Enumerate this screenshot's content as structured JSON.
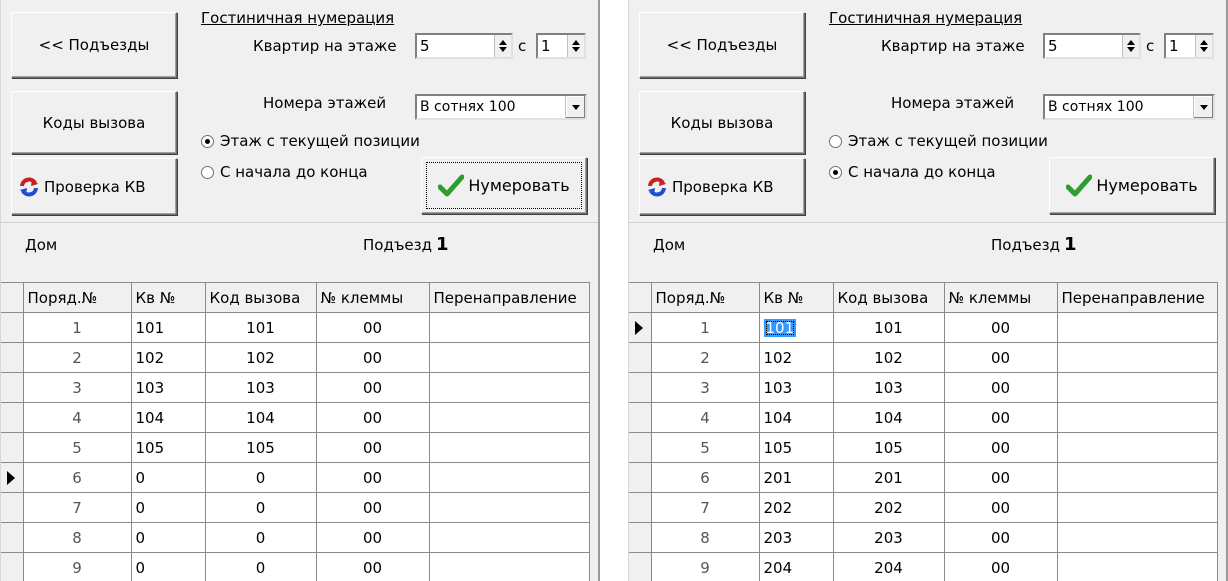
{
  "left": {
    "nav_button": "<< Подъезды",
    "codes_button": "Коды вызова",
    "check_button": "Проверка КВ",
    "hotel_link": "Гостиничная нумерация",
    "apt_per_floor_label": "Квартир на этаже",
    "apt_per_floor_value": "5",
    "from_label": "с",
    "from_value": "1",
    "floor_numbers_label": "Номера этажей",
    "floor_numbers_value": "В сотнях  100",
    "radio_current": "Этаж с текущей позиции",
    "radio_start": "С начала до конца",
    "selected_radio": "current",
    "number_button": "Нумеровать",
    "house_label": "Дом",
    "entrance_label": "Подъезд",
    "entrance_value": "1",
    "columns": [
      "Поряд.№",
      "Кв №",
      "Код вызова",
      "№ клеммы",
      "Перенаправление"
    ],
    "rows": [
      [
        "1",
        "101",
        "101",
        "00",
        ""
      ],
      [
        "2",
        "102",
        "102",
        "00",
        ""
      ],
      [
        "3",
        "103",
        "103",
        "00",
        ""
      ],
      [
        "4",
        "104",
        "104",
        "00",
        ""
      ],
      [
        "5",
        "105",
        "105",
        "00",
        ""
      ],
      [
        "6",
        "0",
        "0",
        "00",
        ""
      ],
      [
        "7",
        "0",
        "0",
        "00",
        ""
      ],
      [
        "8",
        "0",
        "0",
        "00",
        ""
      ],
      [
        "9",
        "0",
        "0",
        "00",
        ""
      ]
    ],
    "current_row": 5
  },
  "right": {
    "nav_button": "<< Подъезды",
    "codes_button": "Коды вызова",
    "check_button": "Проверка КВ",
    "hotel_link": "Гостиничная нумерация",
    "apt_per_floor_label": "Квартир на этаже",
    "apt_per_floor_value": "5",
    "from_label": "с",
    "from_value": "1",
    "floor_numbers_label": "Номера этажей",
    "floor_numbers_value": "В сотнях  100",
    "radio_current": "Этаж с текущей позиции",
    "radio_start": "С начала до конца",
    "selected_radio": "start",
    "number_button": "Нумеровать",
    "house_label": "Дом",
    "entrance_label": "Подъезд",
    "entrance_value": "1",
    "columns": [
      "Поряд.№",
      "Кв №",
      "Код вызова",
      "№ клеммы",
      "Перенаправление"
    ],
    "rows": [
      [
        "1",
        "101",
        "101",
        "00",
        ""
      ],
      [
        "2",
        "102",
        "102",
        "00",
        ""
      ],
      [
        "3",
        "103",
        "103",
        "00",
        ""
      ],
      [
        "4",
        "104",
        "104",
        "00",
        ""
      ],
      [
        "5",
        "105",
        "105",
        "00",
        ""
      ],
      [
        "6",
        "201",
        "201",
        "00",
        ""
      ],
      [
        "7",
        "202",
        "202",
        "00",
        ""
      ],
      [
        "8",
        "203",
        "203",
        "00",
        ""
      ],
      [
        "9",
        "204",
        "204",
        "00",
        ""
      ]
    ],
    "current_row": 0
  },
  "colors": {
    "face": "#f0f0f0",
    "selection": "#3399ff",
    "check_green": "#2e9e2e",
    "refresh_red": "#cc1f1f",
    "refresh_blue": "#1f4fcc"
  }
}
